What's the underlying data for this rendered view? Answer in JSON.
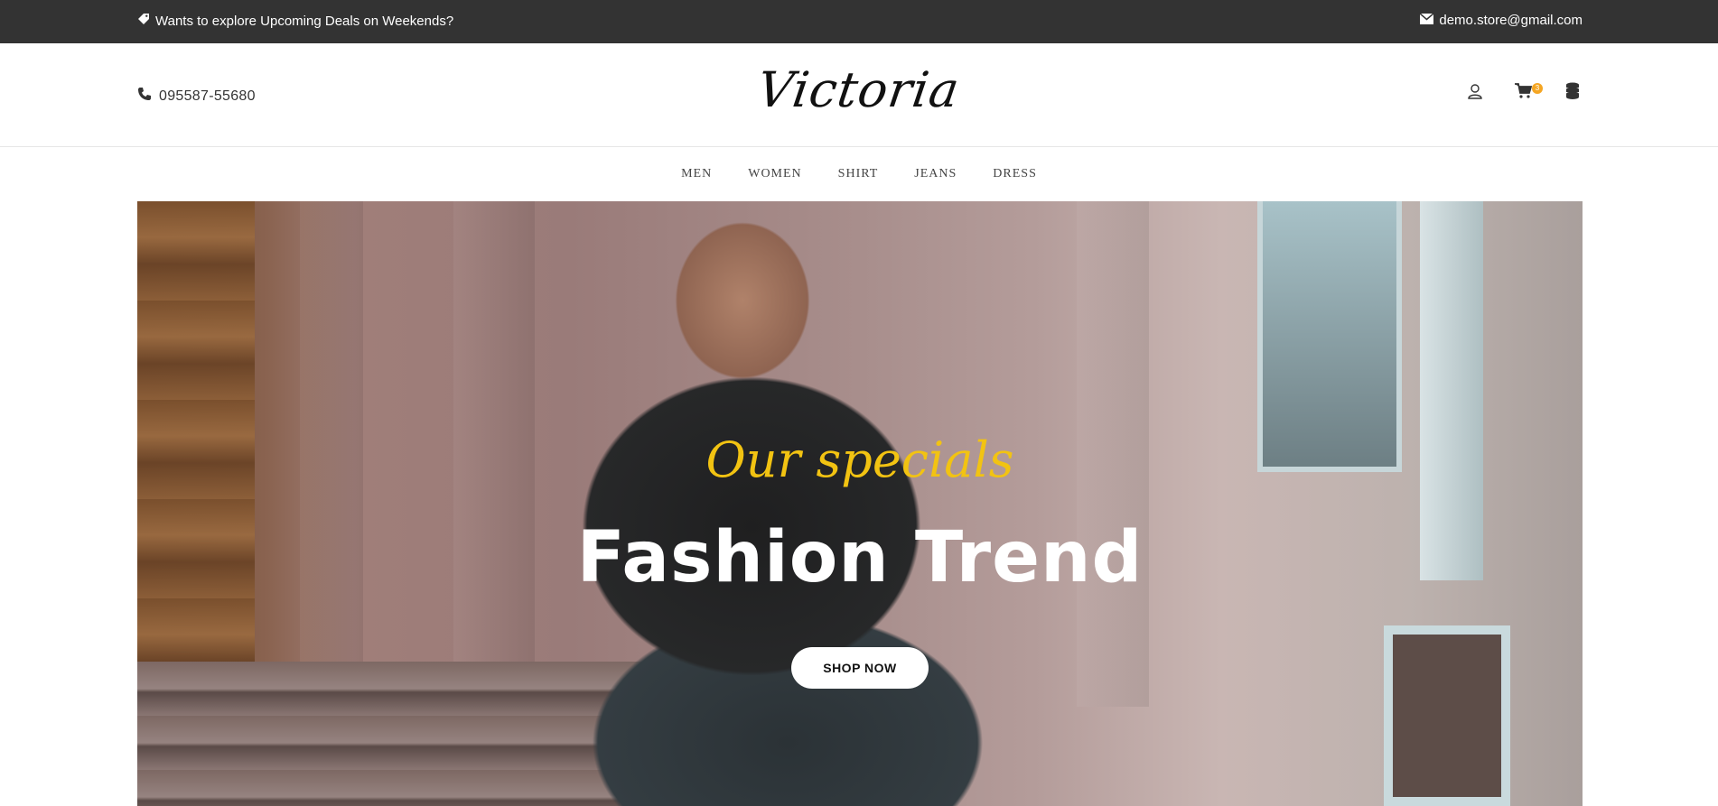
{
  "topbar": {
    "promo_text": "Wants to explore Upcoming Deals on Weekends?",
    "promo_icon": "tag-icon",
    "email": "demo.store@gmail.com",
    "email_icon": "envelope-icon",
    "background": "#333333"
  },
  "header": {
    "phone": "095587-55680",
    "phone_icon": "phone-icon",
    "logo": "Victoria",
    "icons": [
      "user-icon",
      "cart-icon",
      "coins-icon"
    ],
    "cart_count": "3",
    "badge_color": "#f5a623"
  },
  "nav": {
    "items": [
      {
        "label": "MEN"
      },
      {
        "label": "WOMEN"
      },
      {
        "label": "SHIRT"
      },
      {
        "label": "JEANS"
      },
      {
        "label": "DRESS"
      }
    ]
  },
  "hero": {
    "tagline": "Our specials",
    "headline": "Fashion Trend",
    "button_label": "SHOP NOW",
    "tagline_color": "#f2c312"
  }
}
